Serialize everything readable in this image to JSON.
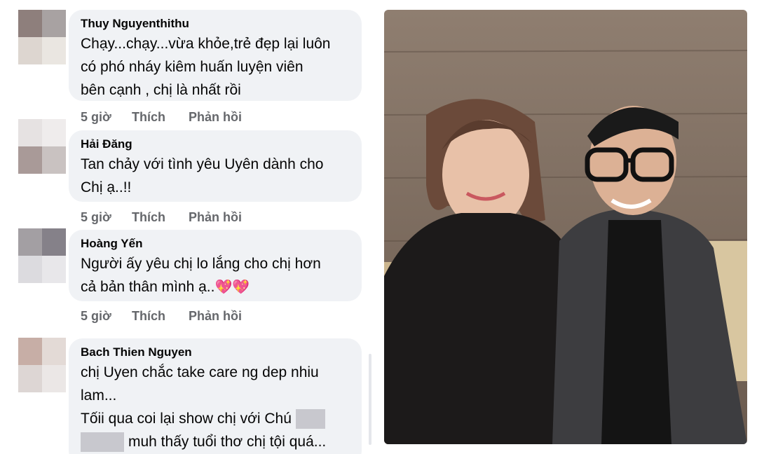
{
  "comments": [
    {
      "author": "Thuy Nguyenthithu",
      "lines": [
        "Chạy...chạy...vừa khỏe,trẻ đẹp lại luôn",
        "có phó nháy kiêm huấn luyện viên",
        "bên cạnh , chị là nhất rồi"
      ],
      "time": "5 giờ",
      "like": "Thích",
      "reply": "Phản hồi"
    },
    {
      "author": "Hải Đăng",
      "lines": [
        "Tan chảy với tình yêu Uyên dành cho",
        "Chị ạ..!!"
      ],
      "time": "5 giờ",
      "like": "Thích",
      "reply": "Phản hồi"
    },
    {
      "author": "Hoàng Yến",
      "lines": [
        "Người ấy yêu chị lo lắng cho chị hơn",
        "cả bản thân mình ạ.."
      ],
      "emoji": "💖💖",
      "time": "5 giờ",
      "like": "Thích",
      "reply": "Phản hồi"
    },
    {
      "author": "Bach Thien Nguyen",
      "lines": [
        "chị Uyen chắc take care ng dep nhiu",
        "lam...",
        "Tốii qua coi lại show chị với Chú",
        "muh thấy tuổi thơ chị tội quá..."
      ]
    }
  ],
  "colors": {
    "bubble": "#f0f2f5",
    "secondary_text": "#65676b",
    "photo_wall": "#8a7868",
    "photo_sofa": "#d8c6a0"
  }
}
